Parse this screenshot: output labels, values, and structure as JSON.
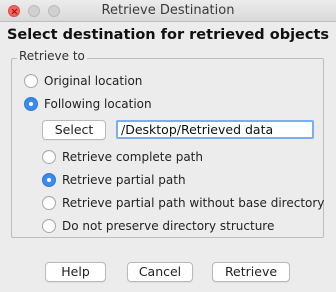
{
  "window": {
    "title": "Retrieve Destination"
  },
  "heading": "Select destination for retrieved objects",
  "retrieve_group": {
    "legend": "Retrieve to",
    "options": [
      {
        "label": "Original location",
        "selected": false
      },
      {
        "label": "Following location",
        "selected": true
      }
    ],
    "select_button": "Select",
    "path_value": "/Desktop/Retrieved data",
    "path_options": [
      {
        "label": "Retrieve complete path",
        "selected": false
      },
      {
        "label": "Retrieve partial path",
        "selected": true
      },
      {
        "label": "Retrieve partial path without base directory",
        "selected": false
      },
      {
        "label": "Do not preserve directory structure",
        "selected": false
      }
    ]
  },
  "footer": {
    "help": "Help",
    "cancel": "Cancel",
    "retrieve": "Retrieve"
  },
  "colors": {
    "accent": "#3b8cf1",
    "close": "#fc605c",
    "focus_ring": "#79aef5"
  }
}
